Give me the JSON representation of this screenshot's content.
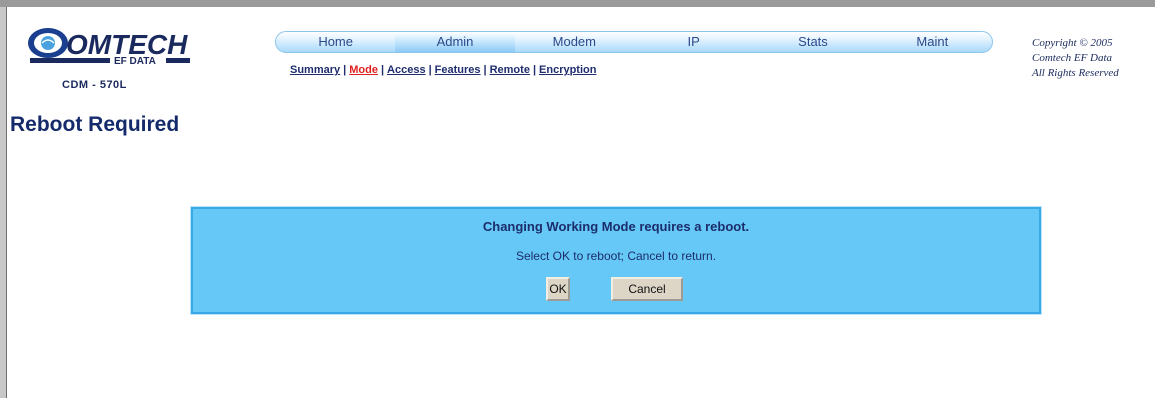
{
  "logo": {
    "brand": "OMTECH",
    "tagline": "EF DATA",
    "model": "CDM - 570L"
  },
  "nav": {
    "tabs": [
      {
        "label": "Home",
        "active": false
      },
      {
        "label": "Admin",
        "active": true
      },
      {
        "label": "Modem",
        "active": false
      },
      {
        "label": "IP",
        "active": false
      },
      {
        "label": "Stats",
        "active": false
      },
      {
        "label": "Maint",
        "active": false
      }
    ]
  },
  "subnav": {
    "items": [
      "Summary",
      "Mode",
      "Access",
      "Features",
      "Remote",
      "Encryption"
    ],
    "current": "Mode"
  },
  "copyright": {
    "line1": "Copyright © 2005",
    "line2": "Comtech EF Data",
    "line3": "All Rights Reserved"
  },
  "page": {
    "title": "Reboot Required"
  },
  "dialog": {
    "title": "Changing Working Mode requires a reboot.",
    "message": "Select OK to reboot; Cancel to return.",
    "ok_label": "OK",
    "cancel_label": "Cancel"
  },
  "colors": {
    "dialog_bg": "#66c8f7",
    "title_text": "#142a6a",
    "active_link": "#e02020"
  }
}
